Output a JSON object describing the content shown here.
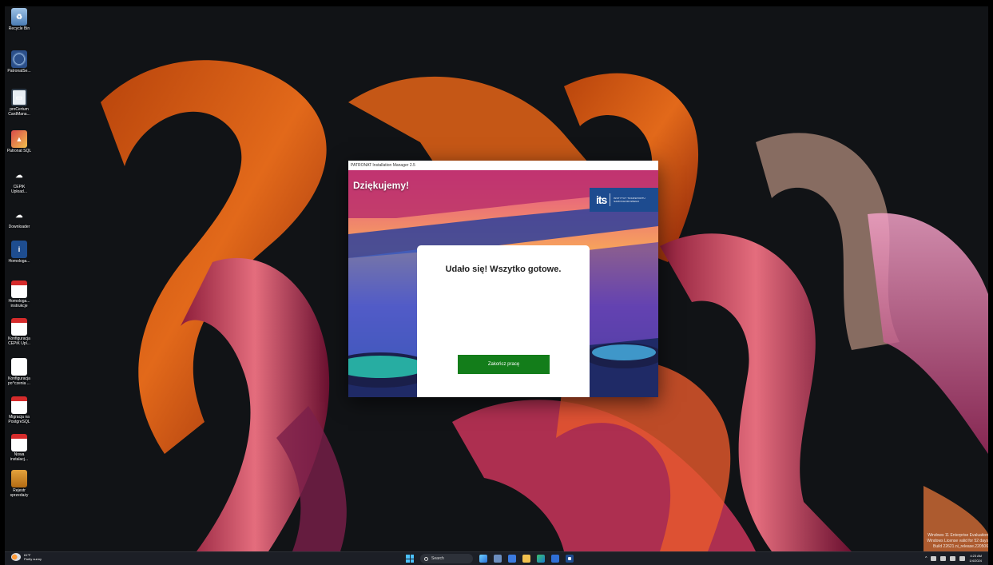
{
  "desktop_icons": [
    {
      "label": "Recycle Bin",
      "icon": "recycle-bin-icon"
    },
    {
      "label": "PatronatSe...",
      "icon": "patronat-service-icon"
    },
    {
      "label": "proCertum CardMana...",
      "icon": "card-manager-icon"
    },
    {
      "label": "Patronat SQL",
      "icon": "patronat-sql-icon"
    },
    {
      "label": "CEPiK Upload...",
      "icon": "cepik-upload-icon"
    },
    {
      "label": "Downloader",
      "icon": "downloader-icon"
    },
    {
      "label": "Homologa...",
      "icon": "its-homologation-icon"
    },
    {
      "label": "Homologa... instrukcje",
      "icon": "pdf-icon"
    },
    {
      "label": "Konfiguracja CEPiK Upl...",
      "icon": "pdf-icon"
    },
    {
      "label": "Konfiguracja po^czenia ...",
      "icon": "red-c-icon"
    },
    {
      "label": "Migracja na PostgreSQL",
      "icon": "pdf-icon"
    },
    {
      "label": "Nowa instalacj...",
      "icon": "pdf-icon"
    },
    {
      "label": "Rejestr sprzedaży",
      "icon": "register-box-icon"
    }
  ],
  "window": {
    "title": "PATRONAT Installation Manager 2.5",
    "hero_title": "Dziękujemy!",
    "logo_mark": "its",
    "logo_text": "INSTYTUT TRANSPORTU SAMOCHODOWEGO",
    "message": "Udało się! Wszytko gotowe.",
    "finish_button": "Zakończ pracę"
  },
  "watermark": {
    "line1": "Windows 11 Enterprise Evaluation",
    "line2": "Windows License valid for 52 days",
    "line3": "Build 22621.ni_release.220506"
  },
  "taskbar": {
    "weather_temp": "61°F",
    "weather_text": "Partly sunny",
    "search_placeholder": "Search",
    "clock_time": "4:23 AM",
    "clock_date": "1/4/2024"
  },
  "colors": {
    "accent_green": "#137d1a",
    "its_blue": "#1d4b8f"
  }
}
